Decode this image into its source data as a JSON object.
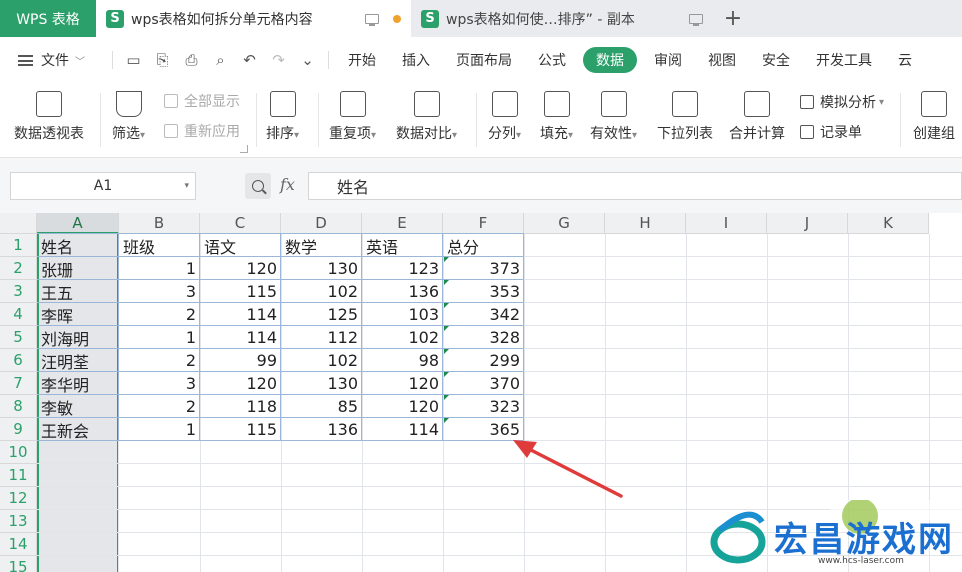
{
  "tabbar": {
    "brand": "WPS 表格",
    "tabs": [
      {
        "title": "wps表格如何拆分单元格内容",
        "active": true
      },
      {
        "title": "wps表格如何使…排序”  - 副本",
        "active": false
      }
    ],
    "new_tab": "+"
  },
  "menu": {
    "file_label": "文件",
    "items": [
      "开始",
      "插入",
      "页面布局",
      "公式",
      "数据",
      "审阅",
      "视图",
      "安全",
      "开发工具",
      "云"
    ],
    "active_item": "数据"
  },
  "ribbon": {
    "pivot": "数据透视表",
    "filter": "筛选",
    "show_all": "全部显示",
    "reapply": "重新应用",
    "sort": "排序",
    "duplicates": "重复项",
    "compare": "数据对比",
    "split": "分列",
    "fill": "填充",
    "validity": "有效性",
    "dropdown_list": "下拉列表",
    "merge_calc": "合并计算",
    "simulation": "模拟分析",
    "record_form": "记录单",
    "create_group": "创建组"
  },
  "formula_bar": {
    "name_box": "A1",
    "fx": "fx",
    "value": "姓名"
  },
  "sheet": {
    "columns": [
      "A",
      "B",
      "C",
      "D",
      "E",
      "F",
      "G",
      "H",
      "I",
      "J",
      "K"
    ],
    "rows": [
      "1",
      "2",
      "3",
      "4",
      "5",
      "6",
      "7",
      "8",
      "9",
      "10",
      "11",
      "12",
      "13",
      "14",
      "15"
    ],
    "header": [
      "姓名",
      "班级",
      "语文",
      "数学",
      "英语",
      "总分"
    ],
    "data": [
      [
        "张珊",
        "1",
        "120",
        "130",
        "123",
        "373"
      ],
      [
        "王五",
        "3",
        "115",
        "102",
        "136",
        "353"
      ],
      [
        "李晖",
        "2",
        "114",
        "125",
        "103",
        "342"
      ],
      [
        "刘海明",
        "1",
        "114",
        "112",
        "102",
        "328"
      ],
      [
        "汪明荃",
        "2",
        "99",
        "102",
        "98",
        "299"
      ],
      [
        "李华明",
        "3",
        "120",
        "130",
        "120",
        "370"
      ],
      [
        "李敏",
        "2",
        "118",
        "85",
        "120",
        "323"
      ],
      [
        "王新会",
        "1",
        "115",
        "136",
        "114",
        "365"
      ]
    ]
  },
  "watermark": {
    "title": "宏昌游戏网",
    "url": "www.hcs-laser.com"
  },
  "colors": {
    "accent": "#2ba06a",
    "annotation_arrow": "#e03b3b"
  }
}
